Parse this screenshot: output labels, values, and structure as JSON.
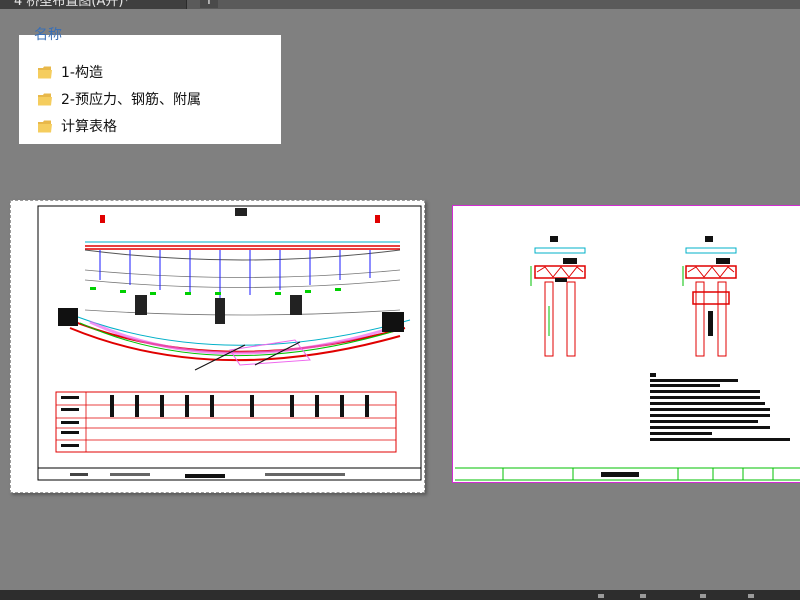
{
  "tab": {
    "title": "4 桥型布置图(A开)*",
    "close_glyph": "✕",
    "add_glyph": "+"
  },
  "file_popup": {
    "title": "名称",
    "items": [
      {
        "label": "1-构造",
        "icon": "folder-icon"
      },
      {
        "label": "2-预应力、钢筋、附属",
        "icon": "folder-icon"
      },
      {
        "label": "计算表格",
        "icon": "folder-icon"
      }
    ]
  },
  "colors": {
    "workspace": "#808080",
    "layout_frame": "#d22bd2",
    "drawing_red": "#e00000",
    "drawing_green": "#00c000",
    "drawing_cyan": "#00b0c8",
    "folder": "#e8b84a"
  }
}
